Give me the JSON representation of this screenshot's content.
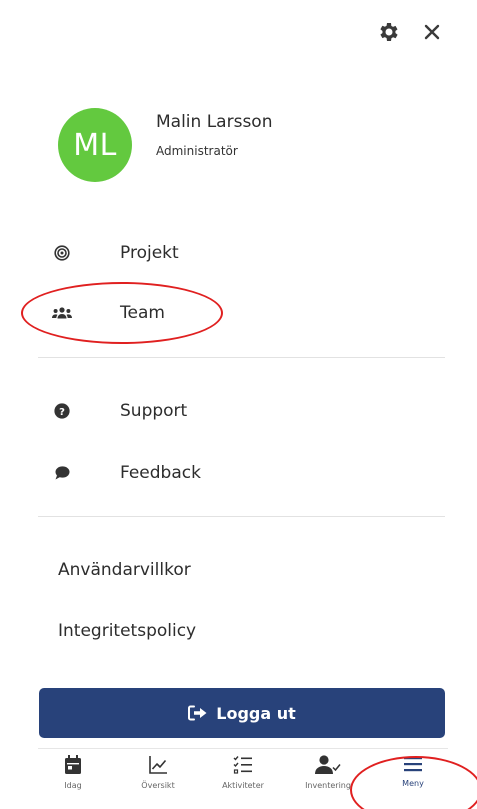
{
  "header": {
    "settings_icon": "gear-icon",
    "close_icon": "close-icon"
  },
  "profile": {
    "initials": "ML",
    "name": "Malin Larsson",
    "role": "Administratör",
    "avatar_color": "#63c93f"
  },
  "menu": {
    "items": [
      {
        "label": "Projekt",
        "icon": "target-icon"
      },
      {
        "label": "Team",
        "icon": "team-icon"
      },
      {
        "label": "Support",
        "icon": "question-circle-icon"
      },
      {
        "label": "Feedback",
        "icon": "chat-bubble-icon"
      }
    ]
  },
  "links": {
    "terms": "Användarvillkor",
    "privacy": "Integritetspolicy"
  },
  "logout": {
    "label": "Logga ut",
    "icon": "logout-icon",
    "color": "#28427a"
  },
  "bottom_nav": {
    "items": [
      {
        "label": "Idag",
        "icon": "calendar-icon"
      },
      {
        "label": "Översikt",
        "icon": "line-chart-icon"
      },
      {
        "label": "Aktiviteter",
        "icon": "checklist-icon"
      },
      {
        "label": "Inventering",
        "icon": "user-check-icon"
      },
      {
        "label": "Meny",
        "icon": "hamburger-icon"
      }
    ],
    "active": "Meny",
    "active_color": "#28427a"
  },
  "annotation_color": "#e02020"
}
